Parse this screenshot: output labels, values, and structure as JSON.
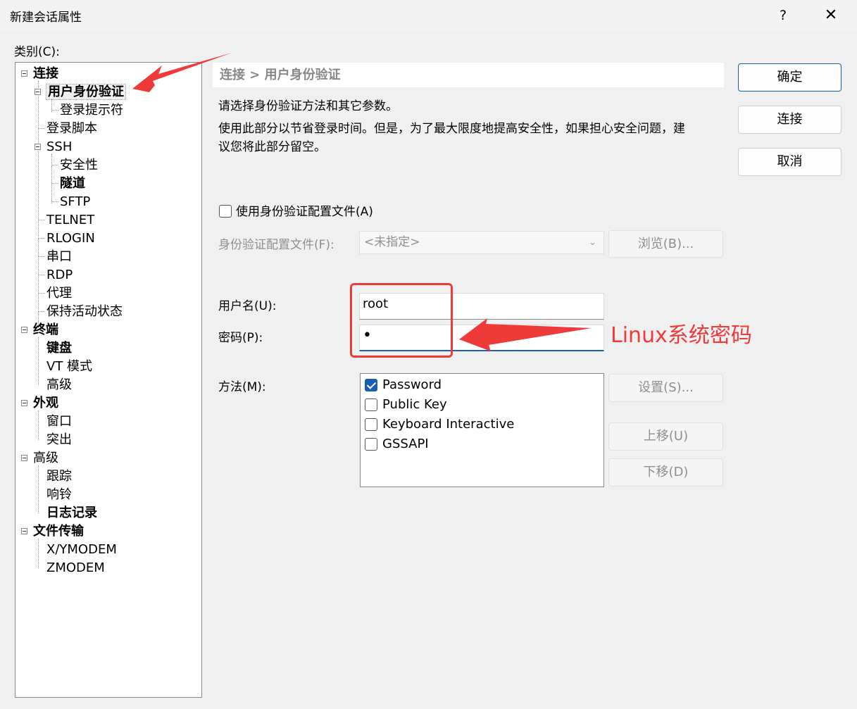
{
  "window": {
    "title": "新建会话属性",
    "help_glyph": "?",
    "close_glyph": "✕"
  },
  "category_label": "类别(C):",
  "tree": {
    "items": [
      {
        "label": "连接",
        "bold": true
      },
      {
        "label": "用户身份验证",
        "bold": true
      },
      {
        "label": "登录提示符",
        "bold": false
      },
      {
        "label": "登录脚本",
        "bold": false
      },
      {
        "label": "SSH",
        "bold": false
      },
      {
        "label": "安全性",
        "bold": false
      },
      {
        "label": "隧道",
        "bold": true
      },
      {
        "label": "SFTP",
        "bold": false
      },
      {
        "label": "TELNET",
        "bold": false
      },
      {
        "label": "RLOGIN",
        "bold": false
      },
      {
        "label": "串口",
        "bold": false
      },
      {
        "label": "RDP",
        "bold": false
      },
      {
        "label": "代理",
        "bold": false
      },
      {
        "label": "保持活动状态",
        "bold": false
      },
      {
        "label": "终端",
        "bold": true
      },
      {
        "label": "键盘",
        "bold": true
      },
      {
        "label": "VT 模式",
        "bold": false
      },
      {
        "label": "高级",
        "bold": false
      },
      {
        "label": "外观",
        "bold": true
      },
      {
        "label": "窗口",
        "bold": false
      },
      {
        "label": "突出",
        "bold": false
      },
      {
        "label": "高级",
        "bold": false
      },
      {
        "label": "跟踪",
        "bold": false
      },
      {
        "label": "响铃",
        "bold": false
      },
      {
        "label": "日志记录",
        "bold": true
      },
      {
        "label": "文件传输",
        "bold": true
      },
      {
        "label": "X/YMODEM",
        "bold": false
      },
      {
        "label": "ZMODEM",
        "bold": false
      }
    ],
    "selected": "用户身份验证"
  },
  "panel": {
    "breadcrumb": "连接 > 用户身份验证",
    "intro": "请选择身份验证方法和其它参数。",
    "description_line1": "使用此部分以节省登录时间。但是，为了最大限度地提高安全性，如果担心安全问题，建",
    "description_line2": "议您将此部分留空。",
    "use_profile_label": "使用身份验证配置文件(A)",
    "use_profile_checked": false,
    "profile_label": "身份验证配置文件(F):",
    "profile_value": "<未指定>",
    "browse_label": "浏览(B)...",
    "username_label": "用户名(U):",
    "username_value": "root",
    "password_label": "密码(P):",
    "password_mask": "•",
    "method_label": "方法(M):",
    "methods": [
      {
        "label": "Password",
        "checked": true
      },
      {
        "label": "Public Key",
        "checked": false
      },
      {
        "label": "Keyboard Interactive",
        "checked": false
      },
      {
        "label": "GSSAPI",
        "checked": false
      }
    ],
    "settings_label": "设置(S)...",
    "move_up_label": "上移(U)",
    "move_down_label": "下移(D)"
  },
  "buttons": {
    "ok": "确定",
    "connect": "连接",
    "cancel": "取消"
  },
  "annotation": {
    "text": "Linux系统密码",
    "color": "#ef3a3a"
  },
  "colors": {
    "accent": "#1a5fb4",
    "annotation": "#ef3a3a"
  }
}
